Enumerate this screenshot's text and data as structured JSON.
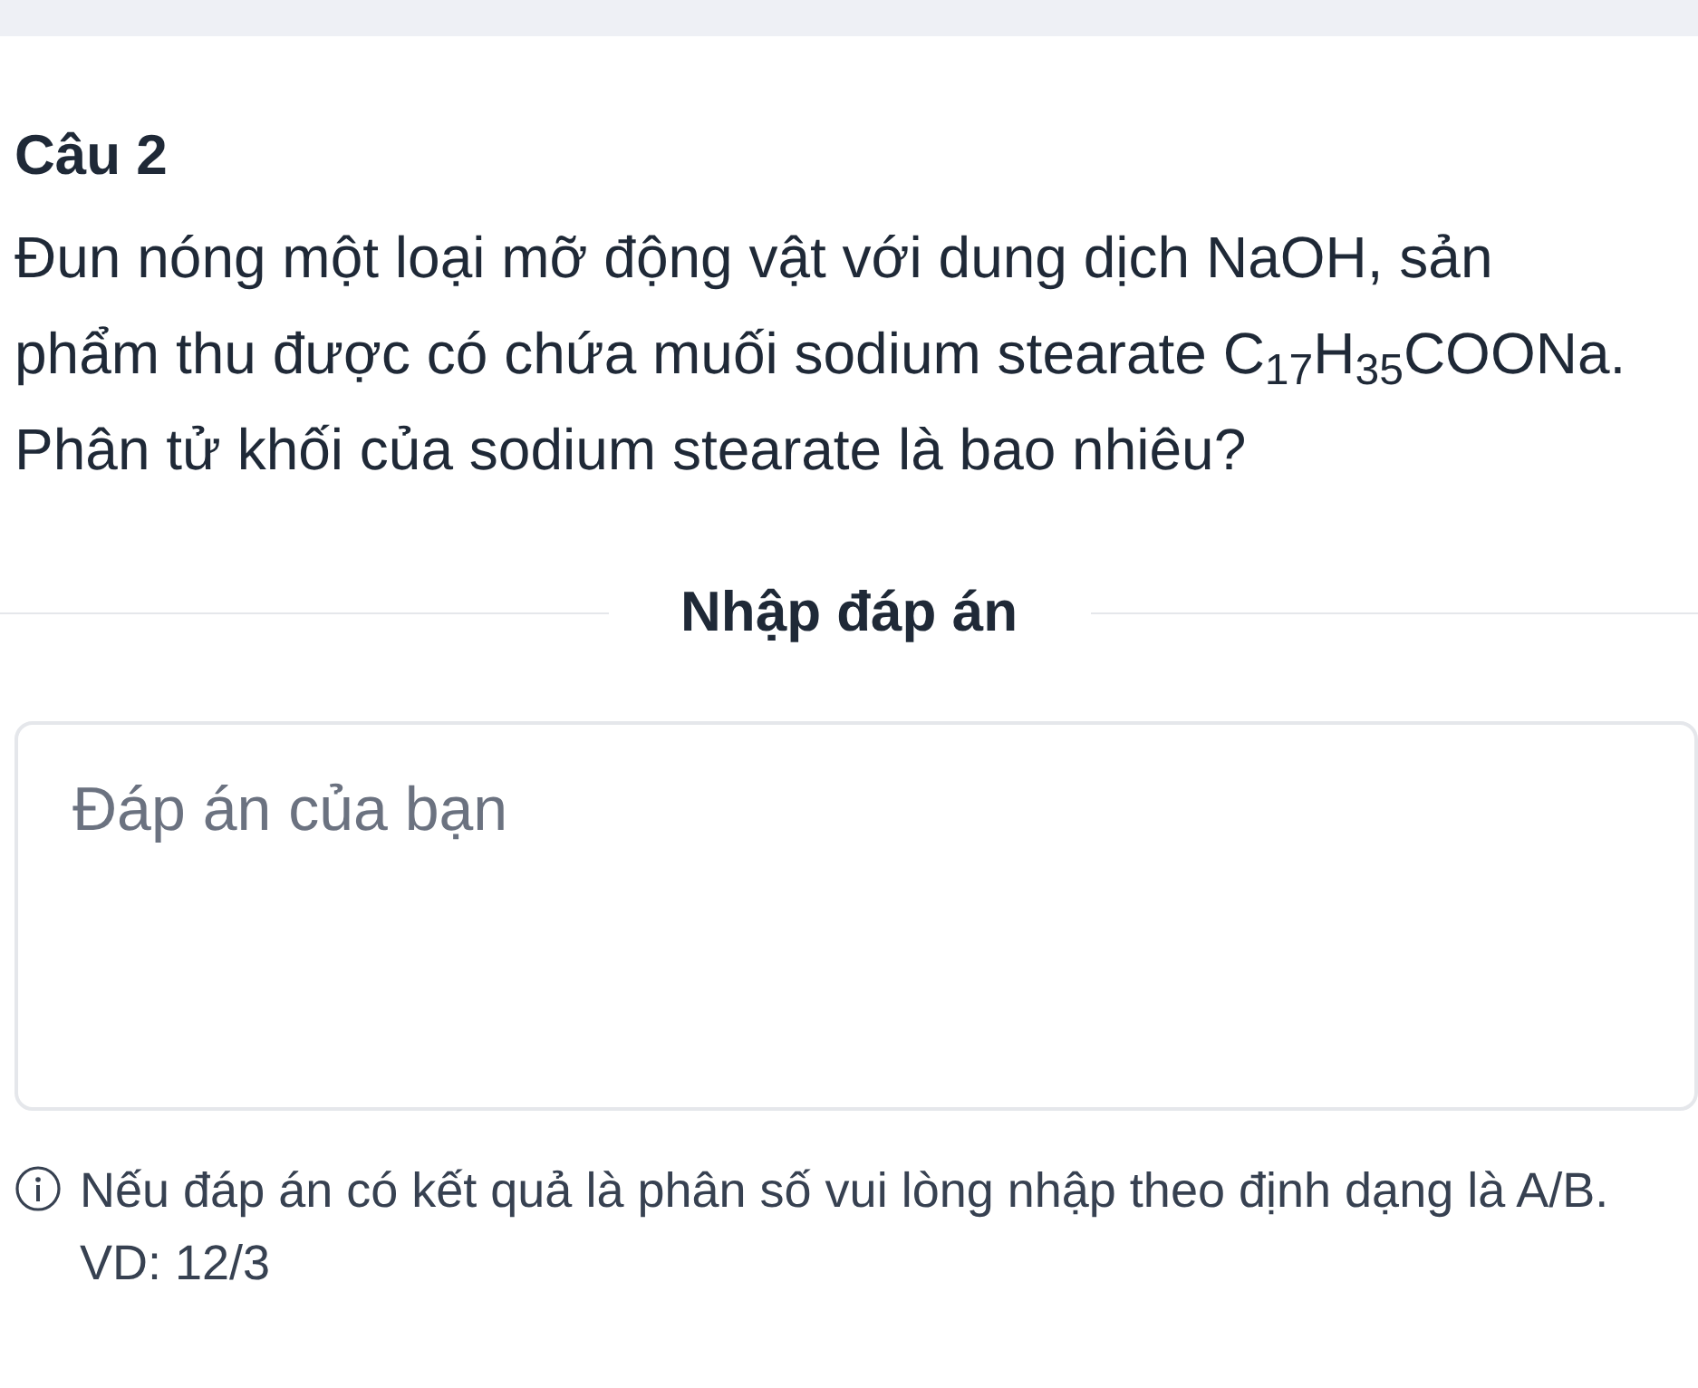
{
  "question": {
    "title": "Câu 2",
    "text": "Đun nóng một loại mỡ động vật với dung dịch NaOH, sản phẩm thu được có chứa muối sodium stearate C$_{17}$H$_{35}$COONa. Phân tử khối của sodium stearate là bao nhiêu?"
  },
  "answer": {
    "heading": "Nhập đáp án",
    "placeholder": "Đáp án của bạn"
  },
  "note": "Nếu đáp án có kết quả là phân số vui lòng nhập theo định dạng là A/B. VD: 12/3"
}
